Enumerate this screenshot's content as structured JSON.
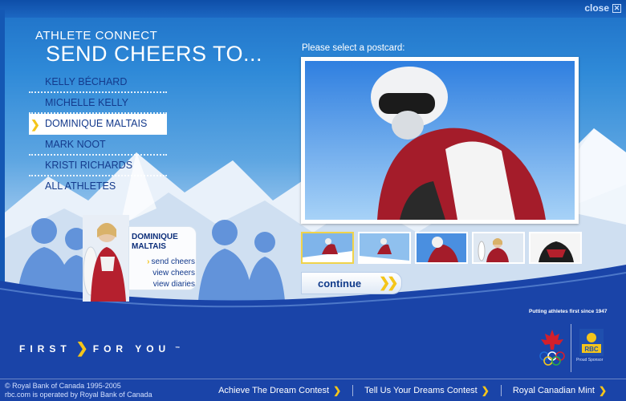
{
  "window": {
    "close_label": "close",
    "close_icon": "x-box-icon"
  },
  "heading": {
    "kicker": "ATHLETE CONNECT",
    "title": "SEND CHEERS TO..."
  },
  "athletes": [
    {
      "name": "KELLY BÉCHARD",
      "active": false
    },
    {
      "name": "MICHELLE KELLY",
      "active": false
    },
    {
      "name": "DOMINIQUE MALTAIS",
      "active": true
    },
    {
      "name": "MARK NOOT",
      "active": false
    },
    {
      "name": "KRISTI RICHARDS",
      "active": false
    },
    {
      "name": "ALL ATHLETES",
      "active": false
    }
  ],
  "profile": {
    "name_line1": "DOMINIQUE",
    "name_line2": "MALTAIS",
    "links": [
      "send cheers",
      "view cheers",
      "view diaries"
    ],
    "active_link": "send cheers"
  },
  "postcards": {
    "label": "Please select a postcard:",
    "thumb_count": 5,
    "selected_index": 0
  },
  "continue_label": "continue",
  "footer": {
    "tagline": "Putting athletes first since 1947",
    "brand_left": "FIRST",
    "brand_right": "FOR YOU",
    "brand_tm": "™",
    "sponsor_caption": "Proud Sponsor",
    "rbc_text": "RBC",
    "copyright_line1": "© Royal Bank of Canada 1995-2005",
    "copyright_line2": "rbc.com is operated by Royal Bank of Canada",
    "links": [
      "Achieve The Dream Contest",
      "Tell Us Your Dreams Contest",
      "Royal Canadian Mint"
    ]
  },
  "colors": {
    "accent_yellow": "#f4c51a",
    "nav_text": "#143a8c",
    "footer_blue": "#1a3f9e"
  }
}
